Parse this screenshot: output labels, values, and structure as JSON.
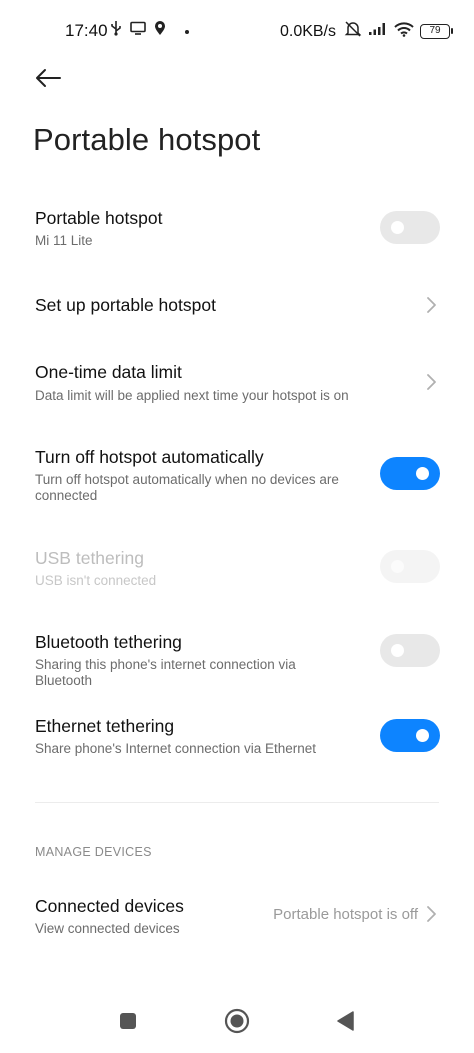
{
  "status_bar": {
    "time": "17:40",
    "net_speed": "0.0KB/s",
    "battery": "79",
    "icons": [
      "usb-icon",
      "screen-icon",
      "location-icon",
      "dot-icon",
      "mute-icon",
      "signal-icon",
      "wifi-icon",
      "battery-icon"
    ]
  },
  "header": {
    "back_icon": "arrow-left-icon",
    "title": "Portable hotspot"
  },
  "settings": {
    "portable_hotspot": {
      "title": "Portable hotspot",
      "subtitle": "Mi 11 Lite",
      "enabled": false
    },
    "setup": {
      "title": "Set up portable hotspot"
    },
    "data_limit": {
      "title": "One-time data limit",
      "subtitle": "Data limit will be applied next time your hotspot is on"
    },
    "auto_off": {
      "title": "Turn off hotspot automatically",
      "subtitle": "Turn off hotspot automatically when no devices are connected",
      "enabled": true
    },
    "usb": {
      "title": "USB tethering",
      "subtitle": "USB isn't connected",
      "enabled": false,
      "disabled": true
    },
    "bluetooth": {
      "title": "Bluetooth tethering",
      "subtitle": "Sharing this phone's internet connection via Bluetooth",
      "enabled": false
    },
    "ethernet": {
      "title": "Ethernet tethering",
      "subtitle": "Share phone's Internet connection via Ethernet",
      "enabled": true
    }
  },
  "manage_devices": {
    "header": "MANAGE DEVICES",
    "connected": {
      "title": "Connected devices",
      "subtitle": "View connected devices",
      "value": "Portable hotspot is off"
    }
  },
  "colors": {
    "accent": "#0d84ff",
    "toggle_off": "#e8e8e8",
    "secondary_text": "#6c6c6c"
  },
  "nav_bar": {
    "icons": [
      "square-recents-icon",
      "circle-home-icon",
      "triangle-back-icon"
    ]
  }
}
